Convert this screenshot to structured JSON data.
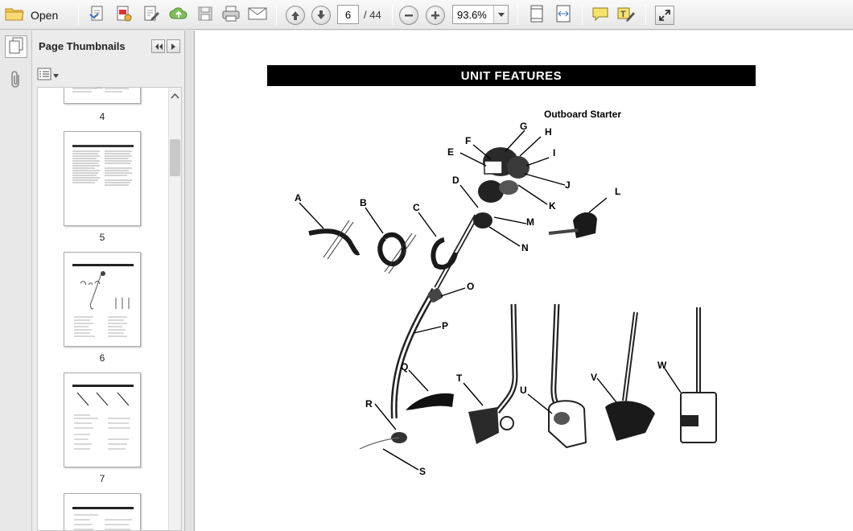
{
  "toolbar": {
    "open_label": "Open",
    "current_page": "6",
    "page_total": "/ 44",
    "zoom_value": "93.6%"
  },
  "sidebar": {
    "title": "Page Thumbnails",
    "thumbnails": [
      {
        "page": "4"
      },
      {
        "page": "5"
      },
      {
        "page": "6"
      },
      {
        "page": "7"
      }
    ]
  },
  "document": {
    "section_title": "UNIT FEATURES",
    "starter_label": "Outboard Starter",
    "callouts": [
      "A",
      "B",
      "C",
      "D",
      "E",
      "F",
      "G",
      "H",
      "I",
      "J",
      "K",
      "L",
      "M",
      "N",
      "O",
      "P",
      "Q",
      "R",
      "S",
      "T",
      "U",
      "V",
      "W"
    ]
  }
}
